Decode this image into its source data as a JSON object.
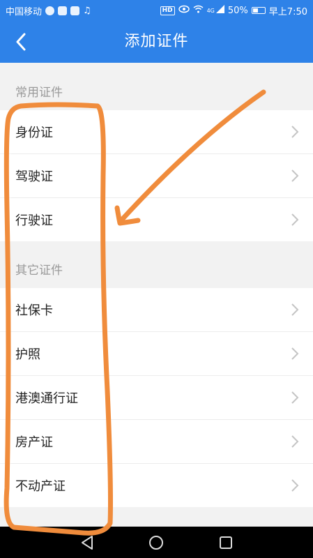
{
  "statusbar": {
    "carrier": "中国移动",
    "network": "4G",
    "battery": "50%",
    "time": "早上7:50",
    "hd": "HD"
  },
  "header": {
    "title": "添加证件",
    "back_icon": "chevron-left-icon"
  },
  "sections": [
    {
      "title": "常用证件",
      "items": [
        "身份证",
        "驾驶证",
        "行驶证"
      ]
    },
    {
      "title": "其它证件",
      "items": [
        "社保卡",
        "护照",
        "港澳通行证",
        "房产证",
        "不动产证"
      ]
    }
  ],
  "colors": {
    "header_bg": "#2e82e8",
    "annotation": "#f08c3c",
    "page_bg": "#f2f2f2"
  }
}
